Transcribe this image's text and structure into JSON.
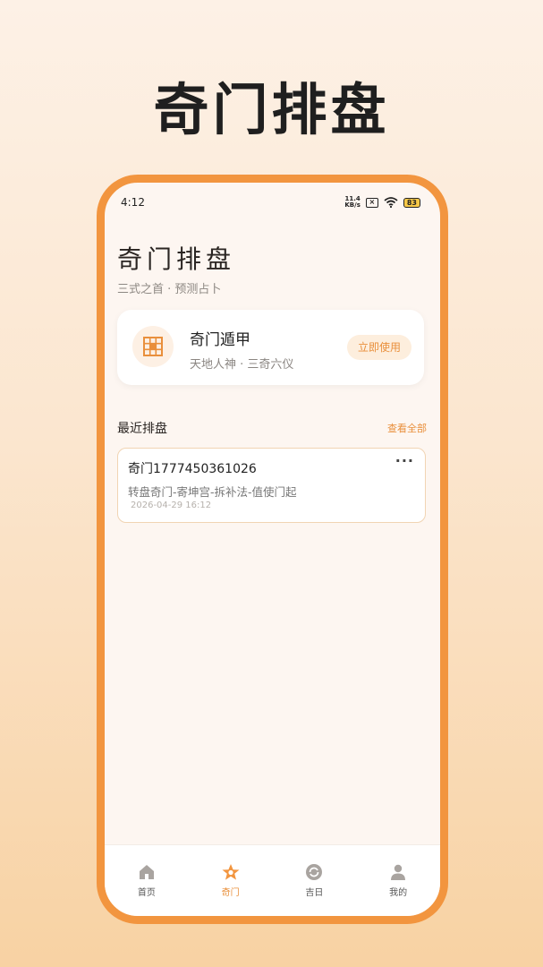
{
  "promo": {
    "title": "奇门排盘"
  },
  "status_bar": {
    "time": "4:12",
    "net_speed_value": "11.4",
    "net_speed_unit": "KB/s",
    "battery": "83"
  },
  "header": {
    "title": "奇门排盘",
    "subtitle": "三式之首 · 预测占卜"
  },
  "feature": {
    "name": "奇门遁甲",
    "desc": "天地人神 · 三奇六仪",
    "button": "立即使用",
    "icon": "grid-icon"
  },
  "recent": {
    "title": "最近排盘",
    "view_all": "查看全部",
    "items": [
      {
        "title": "奇门1777450361026",
        "desc": "转盘奇门-寄坤宫-拆补法-值使门起",
        "date": "2026-04-29 16:12",
        "more": "···"
      }
    ]
  },
  "tabs": [
    {
      "label": "首页",
      "icon": "home-icon",
      "active": false
    },
    {
      "label": "奇门",
      "icon": "star-icon",
      "active": true
    },
    {
      "label": "吉日",
      "icon": "refresh-circle-icon",
      "active": false
    },
    {
      "label": "我的",
      "icon": "user-icon",
      "active": false
    }
  ],
  "colors": {
    "accent": "#f2953f",
    "accent_text": "#e98f3b",
    "background_top": "#fdf1e6",
    "background_bottom": "#f8d2a3"
  }
}
